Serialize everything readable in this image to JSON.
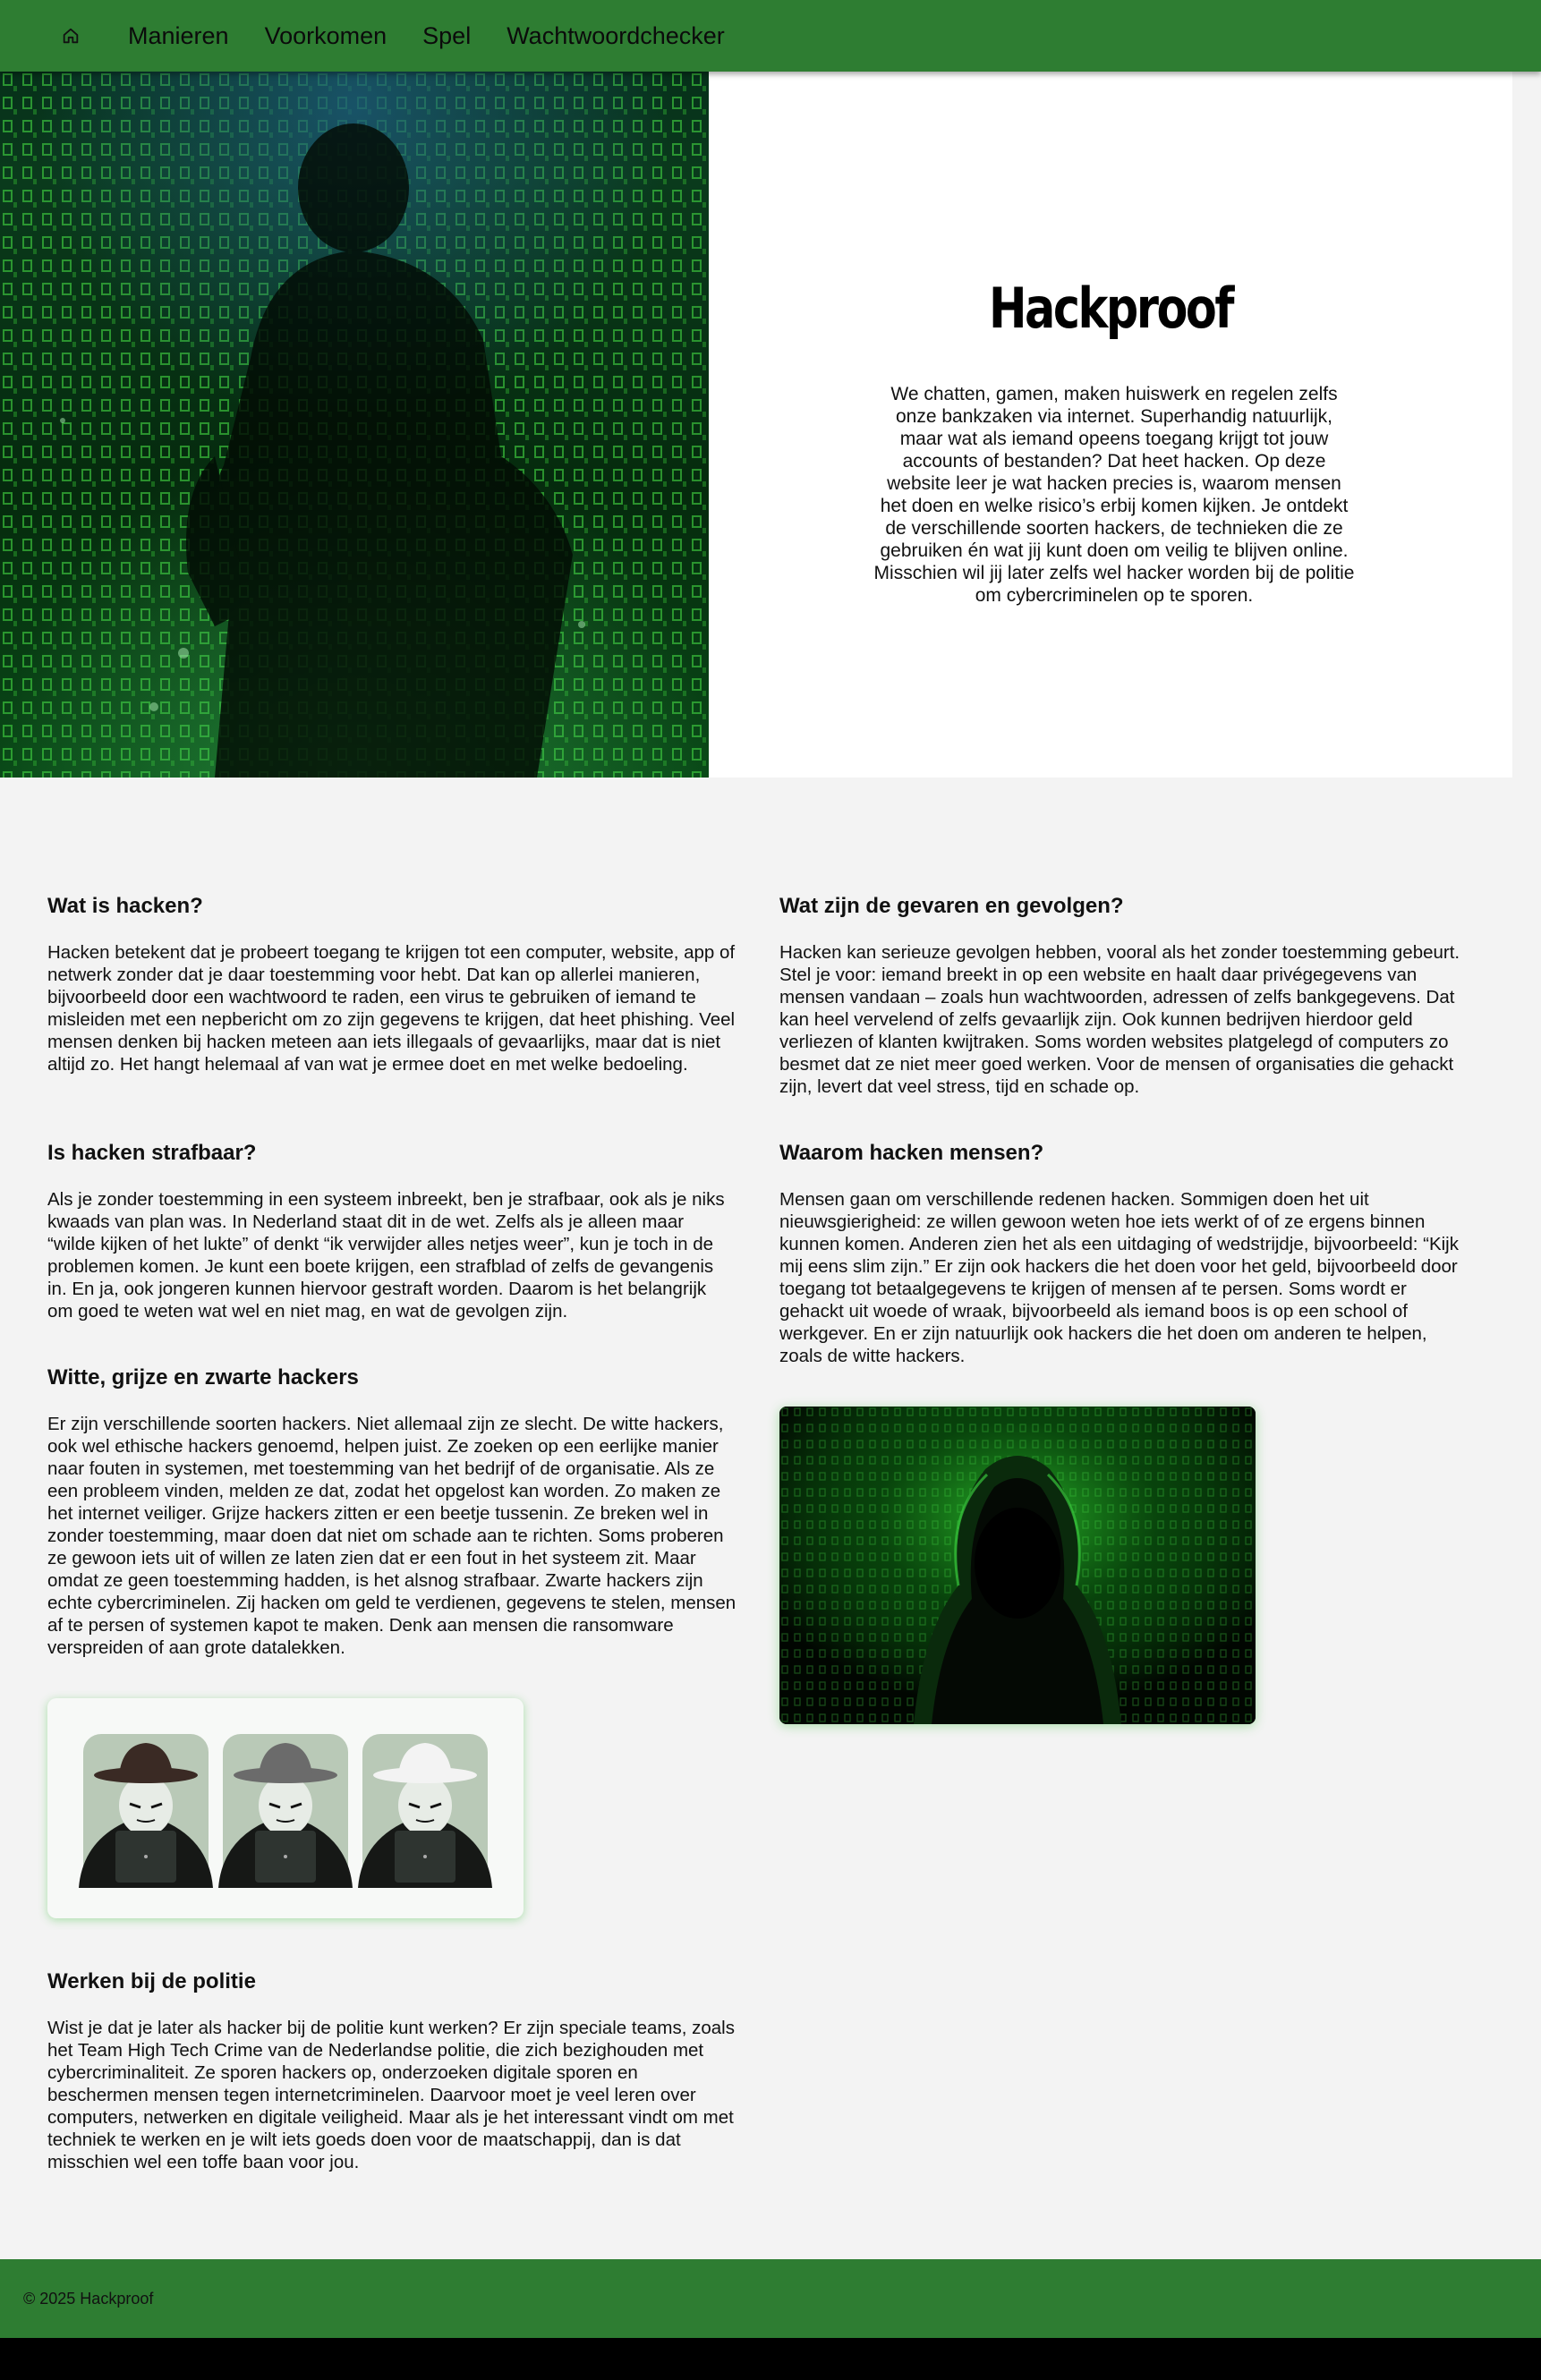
{
  "nav": {
    "home_icon": "home-icon",
    "items": [
      {
        "label": "Manieren"
      },
      {
        "label": "Voorkomen"
      },
      {
        "label": "Spel"
      },
      {
        "label": "Wachtwoordchecker"
      }
    ]
  },
  "hero": {
    "title": "Hackproof",
    "text": "We chatten, gamen, maken huiswerk en regelen zelfs onze bankzaken via internet. Superhandig natuurlijk, maar wat als iemand opeens toegang krijgt tot jouw accounts of bestanden? Dat heet hacken. Op deze website leer je wat hacken precies is, waarom mensen het doen en welke risico’s erbij komen kijken. Je ontdekt de verschillende soorten hackers, de technieken die ze gebruiken én wat jij kunt doen om veilig te blijven online. Misschien wil jij later zelfs wel hacker worden bij de politie om cybercriminelen op te sporen."
  },
  "sections": {
    "what": {
      "title": "Wat is hacken?",
      "text": "Hacken betekent dat je probeert toegang te krijgen tot een computer, website, app of netwerk zonder dat je daar toestemming voor hebt. Dat kan op allerlei manieren, bijvoorbeeld door een wachtwoord te raden, een virus te gebruiken of iemand te misleiden met een nepbericht om zo zijn gegevens te krijgen, dat heet phishing. Veel mensen denken bij hacken meteen aan iets illegaals of gevaarlijks, maar dat is niet altijd zo. Het hangt helemaal af van wat je ermee doet en met welke bedoeling."
    },
    "dangers": {
      "title": "Wat zijn de gevaren en gevolgen?",
      "text": "Hacken kan serieuze gevolgen hebben, vooral als het zonder toestemming gebeurt. Stel je voor: iemand breekt in op een website en haalt daar privégegevens van mensen vandaan – zoals hun wachtwoorden, adressen of zelfs bankgegevens. Dat kan heel vervelend of zelfs gevaarlijk zijn. Ook kunnen bedrijven hierdoor geld verliezen of klanten kwijtraken. Soms worden websites platgelegd of computers zo besmet dat ze niet meer goed werken. Voor de mensen of organisaties die gehackt zijn, levert dat veel stress, tijd en schade op."
    },
    "punishable": {
      "title": "Is hacken strafbaar?",
      "text": "Als je zonder toestemming in een systeem inbreekt, ben je strafbaar, ook als je niks kwaads van plan was. In Nederland staat dit in de wet. Zelfs als je alleen maar “wilde kijken of het lukte” of denkt “ik verwijder alles netjes weer”, kun je toch in de problemen komen. Je kunt een boete krijgen, een strafblad of zelfs de gevangenis in. En ja, ook jongeren kunnen hiervoor gestraft worden. Daarom is het belangrijk om goed te weten wat wel en niet mag, en wat de gevolgen zijn."
    },
    "why": {
      "title": "Waarom hacken mensen?",
      "text": "Mensen gaan om verschillende redenen hacken. Sommigen doen het uit nieuwsgierigheid: ze willen gewoon weten hoe iets werkt of of ze ergens binnen kunnen komen. Anderen zien het als een uitdaging of wedstrijdje, bijvoorbeeld: “Kijk mij eens slim zijn.” Er zijn ook hackers die het doen voor het geld, bijvoorbeeld door toegang tot betaalgegevens te krijgen of mensen af te persen. Soms wordt er gehackt uit woede of wraak, bijvoorbeeld als iemand boos is op een school of werkgever. En er zijn natuurlijk ook hackers die het doen om anderen te helpen, zoals de witte hackers."
    },
    "hats": {
      "title": "Witte, grijze en zwarte hackers",
      "text": "Er zijn verschillende soorten hackers. Niet allemaal zijn ze slecht. De witte hackers, ook wel ethische hackers genoemd, helpen juist. Ze zoeken op een eerlijke manier naar fouten in systemen, met toestemming van het bedrijf of de organisatie. Als ze een probleem vinden, melden ze dat, zodat het opgelost kan worden. Zo maken ze het internet veiliger. Grijze hackers zitten er een beetje tussenin. Ze breken wel in zonder toestemming, maar doen dat niet om schade aan te richten. Soms proberen ze gewoon iets uit of willen ze laten zien dat er een fout in het systeem zit. Maar omdat ze geen toestemming hadden, is het alsnog strafbaar. Zwarte hackers zijn echte cybercriminelen. Zij hacken om geld te verdienen, gegevens te stelen, mensen af te persen of systemen kapot te maken. Denk aan mensen die ransomware verspreiden of aan grote datalekken."
    },
    "police": {
      "title": "Werken bij de politie",
      "text": "Wist je dat je later als hacker bij de politie kunt werken? Er zijn speciale teams, zoals het Team High Tech Crime van de Nederlandse politie, die zich bezighouden met cybercriminaliteit. Ze sporen hackers op, onderzoeken digitale sporen en beschermen mensen tegen internetcriminelen. Daarvoor moet je veel leren over computers, netwerken en digitale veiligheid. Maar als je het interessant vindt om met techniek te werken en je wilt iets goeds doen voor de maatschappij, dan is dat misschien wel een toffe baan voor jou."
    }
  },
  "footer": {
    "text": "© 2025 Hackproof"
  },
  "colors": {
    "nav": "#2e7d32",
    "footer": "#2e7d32",
    "background": "#f3f3f3"
  }
}
